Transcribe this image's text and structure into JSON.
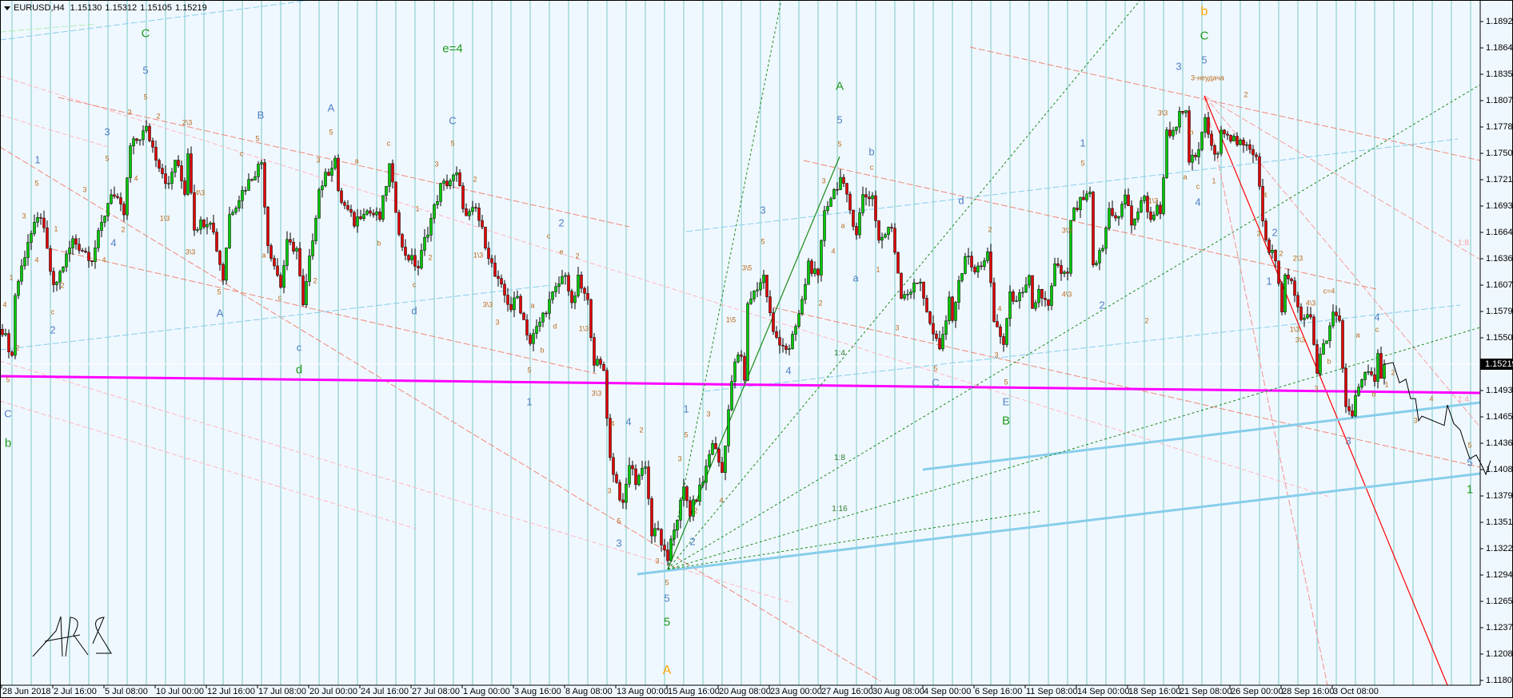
{
  "header": {
    "symbol": "EURUSD,H4",
    "open": "1.15130",
    "high": "1.15312",
    "low": "1.15105",
    "close": "1.15219"
  },
  "chart_data": {
    "type": "candlestick",
    "title": "EURUSD,H4",
    "last_price": "1.15219",
    "ylim": [
      1.1166,
      1.1907
    ],
    "price_ticks": [
      "1.18927",
      "1.18642",
      "1.18357",
      "1.18072",
      "1.17787",
      "1.17502",
      "1.17217",
      "1.16932",
      "1.16647",
      "1.16362",
      "1.16077",
      "1.15792",
      "1.15507",
      "1.14937",
      "1.14652",
      "1.14367",
      "1.14082",
      "1.13797",
      "1.13512",
      "1.13227",
      "1.12942",
      "1.12657",
      "1.12372",
      "1.12087",
      "1.11802"
    ],
    "time_ticks": [
      "28 Jun 2018",
      "2 Jul 16:00",
      "5 Jul 08:00",
      "10 Jul 00:00",
      "12 Jul 16:00",
      "17 Jul 08:00",
      "20 Jul 00:00",
      "24 Jul 16:00",
      "27 Jul 08:00",
      "1 Aug 00:00",
      "3 Aug 16:00",
      "8 Aug 08:00",
      "13 Aug 00:00",
      "15 Aug 16:00",
      "20 Aug 08:00",
      "23 Aug 00:00",
      "27 Aug 16:00",
      "30 Aug 08:00",
      "4 Sep 00:00",
      "6 Sep 16:00",
      "11 Sep 08:00",
      "14 Sep 00:00",
      "18 Sep 16:00",
      "21 Sep 08:00",
      "26 Sep 00:00",
      "28 Sep 16:00",
      "3 Oct 08:00"
    ],
    "pivots_bar_price": [
      [
        0,
        1.156
      ],
      [
        3,
        1.1531
      ],
      [
        4,
        1.1598
      ],
      [
        8,
        1.1656
      ],
      [
        12,
        1.1684
      ],
      [
        16,
        1.1603
      ],
      [
        22,
        1.1656
      ],
      [
        28,
        1.1637
      ],
      [
        34,
        1.1709
      ],
      [
        38,
        1.1684
      ],
      [
        40,
        1.1757
      ],
      [
        45,
        1.1776
      ],
      [
        48,
        1.1747
      ],
      [
        52,
        1.1714
      ],
      [
        54,
        1.1744
      ],
      [
        57,
        1.1709
      ],
      [
        58,
        1.1752
      ],
      [
        60,
        1.1671
      ],
      [
        65,
        1.168
      ],
      [
        69,
        1.1615
      ],
      [
        71,
        1.1684
      ],
      [
        75,
        1.1709
      ],
      [
        81,
        1.1741
      ],
      [
        83,
        1.1653
      ],
      [
        87,
        1.1607
      ],
      [
        89,
        1.1652
      ],
      [
        92,
        1.1647
      ],
      [
        94,
        1.1583
      ],
      [
        99,
        1.1711
      ],
      [
        104,
        1.1745
      ],
      [
        105,
        1.1705
      ],
      [
        110,
        1.1675
      ],
      [
        113,
        1.169
      ],
      [
        118,
        1.168
      ],
      [
        121,
        1.1736
      ],
      [
        125,
        1.1646
      ],
      [
        130,
        1.1627
      ],
      [
        132,
        1.1656
      ],
      [
        137,
        1.1714
      ],
      [
        142,
        1.1726
      ],
      [
        145,
        1.168
      ],
      [
        148,
        1.169
      ],
      [
        154,
        1.1617
      ],
      [
        159,
        1.1583
      ],
      [
        161,
        1.1595
      ],
      [
        165,
        1.1545
      ],
      [
        170,
        1.1583
      ],
      [
        176,
        1.1622
      ],
      [
        178,
        1.1583
      ],
      [
        180,
        1.1613
      ],
      [
        183,
        1.1588
      ],
      [
        185,
        1.1526
      ],
      [
        188,
        1.1516
      ],
      [
        190,
        1.142
      ],
      [
        194,
        1.1367
      ],
      [
        196,
        1.1415
      ],
      [
        198,
        1.1396
      ],
      [
        201,
        1.1415
      ],
      [
        203,
        1.1338
      ],
      [
        205,
        1.1342
      ],
      [
        208,
        1.1304
      ],
      [
        209,
        1.1334
      ],
      [
        211,
        1.1357
      ],
      [
        213,
        1.1386
      ],
      [
        215,
        1.1361
      ],
      [
        219,
        1.1396
      ],
      [
        222,
        1.1439
      ],
      [
        225,
        1.1405
      ],
      [
        227,
        1.1473
      ],
      [
        229,
        1.1526
      ],
      [
        231,
        1.153
      ],
      [
        232,
        1.1502
      ],
      [
        233,
        1.1589
      ],
      [
        238,
        1.1617
      ],
      [
        241,
        1.1555
      ],
      [
        246,
        1.1536
      ],
      [
        250,
        1.1589
      ],
      [
        252,
        1.1632
      ],
      [
        255,
        1.1613
      ],
      [
        257,
        1.169
      ],
      [
        262,
        1.1723
      ],
      [
        264,
        1.1701
      ],
      [
        267,
        1.1665
      ],
      [
        269,
        1.1704
      ],
      [
        272,
        1.1704
      ],
      [
        274,
        1.1656
      ],
      [
        278,
        1.167
      ],
      [
        281,
        1.1598
      ],
      [
        284,
        1.1602
      ],
      [
        287,
        1.1613
      ],
      [
        290,
        1.1564
      ],
      [
        293,
        1.1536
      ],
      [
        296,
        1.1589
      ],
      [
        297,
        1.1575
      ],
      [
        301,
        1.1641
      ],
      [
        304,
        1.1621
      ],
      [
        308,
        1.1641
      ],
      [
        310,
        1.1569
      ],
      [
        313,
        1.1545
      ],
      [
        315,
        1.1595
      ],
      [
        319,
        1.1595
      ],
      [
        321,
        1.1613
      ],
      [
        322,
        1.1579
      ],
      [
        324,
        1.1602
      ],
      [
        327,
        1.1583
      ],
      [
        329,
        1.1627
      ],
      [
        333,
        1.1616
      ],
      [
        334,
        1.168
      ],
      [
        337,
        1.1697
      ],
      [
        340,
        1.1704
      ],
      [
        341,
        1.1627
      ],
      [
        344,
        1.1648
      ],
      [
        346,
        1.169
      ],
      [
        349,
        1.168
      ],
      [
        351,
        1.1706
      ],
      [
        353,
        1.1674
      ],
      [
        357,
        1.1701
      ],
      [
        359,
        1.168
      ],
      [
        361,
        1.169
      ],
      [
        362,
        1.1685
      ],
      [
        364,
        1.1772
      ],
      [
        366,
        1.1775
      ],
      [
        368,
        1.1791
      ],
      [
        370,
        1.1791
      ],
      [
        371,
        1.1742
      ],
      [
        373,
        1.1745
      ],
      [
        375,
        1.1768
      ],
      [
        376,
        1.179
      ],
      [
        378,
        1.1754
      ],
      [
        380,
        1.1745
      ],
      [
        381,
        1.1781
      ],
      [
        384,
        1.1768
      ],
      [
        387,
        1.1759
      ],
      [
        390,
        1.1754
      ],
      [
        392,
        1.175
      ],
      [
        393,
        1.1718
      ],
      [
        394,
        1.168
      ],
      [
        396,
        1.1641
      ],
      [
        397,
        1.1645
      ],
      [
        398,
        1.163
      ],
      [
        400,
        1.1583
      ],
      [
        401,
        1.1616
      ],
      [
        403,
        1.1611
      ],
      [
        405,
        1.1583
      ],
      [
        407,
        1.1569
      ],
      [
        409,
        1.1574
      ],
      [
        411,
        1.1516
      ],
      [
        412,
        1.153
      ],
      [
        414,
        1.155
      ],
      [
        416,
        1.1574
      ],
      [
        418,
        1.1569
      ],
      [
        419,
        1.1516
      ],
      [
        420,
        1.1478
      ],
      [
        422,
        1.1468
      ],
      [
        424,
        1.1503
      ],
      [
        426,
        1.1512
      ],
      [
        427,
        1.151
      ],
      [
        429,
        1.15
      ],
      [
        430,
        1.153
      ],
      [
        431,
        1.1512
      ],
      [
        432,
        1.15219
      ]
    ],
    "forecast_bar_price": [
      [
        432,
        1.15219
      ],
      [
        435,
        1.1524
      ],
      [
        437,
        1.1502
      ],
      [
        439,
        1.1506
      ],
      [
        440.5,
        1.1485
      ],
      [
        442,
        1.1485
      ],
      [
        443,
        1.1461
      ],
      [
        444,
        1.1466
      ],
      [
        451,
        1.1456
      ],
      [
        452,
        1.1478
      ],
      [
        454,
        1.1458
      ],
      [
        456,
        1.1451
      ],
      [
        457.5,
        1.1435
      ],
      [
        459,
        1.142
      ],
      [
        461,
        1.1424
      ],
      [
        463,
        1.1411
      ],
      [
        464,
        1.1403
      ],
      [
        465.5,
        1.1418
      ]
    ],
    "colors": {
      "bull": "#00c800",
      "bear": "#e00000",
      "grid": "#a6dada",
      "support": "#ff00ff",
      "channel": "#87ceeb",
      "background": "#f0f8ff"
    }
  },
  "labels": [
    "C",
    "d",
    "b",
    "e=4",
    "5",
    "3",
    "1",
    "2",
    "4",
    "B",
    "A",
    "C",
    "A",
    "c",
    "C",
    "d",
    "5",
    "3",
    "2",
    "2\\3",
    "5",
    "c",
    "5",
    "3",
    "a",
    "c",
    "5",
    "3",
    "2",
    "5",
    "5",
    "3",
    "4",
    "1",
    "2",
    "3",
    "1",
    "c",
    "2",
    "4",
    "4",
    "2",
    "4",
    "1\\3",
    "4\\3",
    "3\\3",
    "5",
    "a",
    "c",
    "2",
    "b",
    "c",
    "1",
    "2",
    "1\\3",
    "3\\3",
    "3",
    "5",
    "A",
    "5",
    "B",
    "A",
    "2",
    "1",
    "4",
    "3",
    "5",
    "1",
    "2",
    "3",
    "5",
    "b",
    "a",
    "4",
    "C",
    "E",
    "d",
    "e",
    "c",
    "2",
    "a",
    "d",
    "b",
    "5",
    "1\\3",
    "3\\3",
    "4",
    "2",
    "3",
    "5",
    "3",
    "5",
    "3",
    "5",
    "3",
    "2",
    "4",
    "1\\5",
    "3\\5",
    "5",
    "3",
    "5",
    "4",
    "2",
    "c",
    "a",
    "1",
    "3",
    "5",
    "2",
    "4",
    "3",
    "5",
    "1:4",
    "1:8",
    "1:16",
    "b",
    "C",
    "1",
    "5",
    "3",
    "1",
    "2",
    "4",
    "2",
    "1",
    "3",
    "4",
    "5",
    "3-неудача",
    "3\\3",
    "b",
    "a",
    "c",
    "1",
    "2",
    "4",
    "3",
    "2",
    "2\\3",
    "4\\3",
    "c=4",
    "1\\3",
    "3\\3",
    "3",
    "b",
    "a",
    "c",
    "b",
    "1",
    "2",
    "3",
    "4",
    "5",
    "1:8",
    "1:4",
    "5",
    "3\\3",
    "4\\3",
    "1\\3",
    "2"
  ]
}
